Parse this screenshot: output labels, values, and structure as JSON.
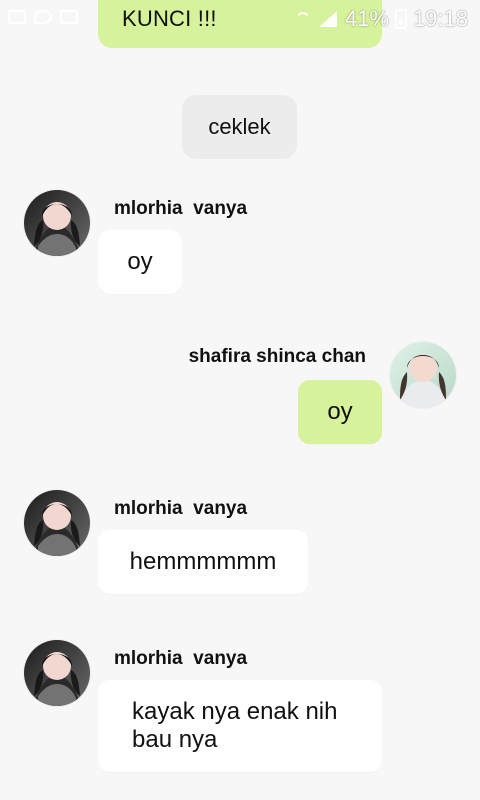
{
  "status_bar": {
    "battery": "41%",
    "time": "19:18",
    "left_icons": [
      "image-icon",
      "chat-icon",
      "youtube-icon"
    ],
    "right_icons": [
      "wifi-icon",
      "signal-icon",
      "battery-icon"
    ]
  },
  "chat": {
    "top_message": "KUNCI !!!",
    "system_message": "ceklek",
    "messages": [
      {
        "sender": "mlorhia  vanya",
        "text": "oy",
        "side": "left",
        "bubble_color": "#ffffff"
      },
      {
        "sender": "shafira shinca chan",
        "text": "oy",
        "side": "right",
        "bubble_color": "#d6f29a"
      },
      {
        "sender": "mlorhia  vanya",
        "text": "hemmmmmm",
        "side": "left",
        "bubble_color": "#ffffff"
      },
      {
        "sender": "mlorhia  vanya",
        "text": "kayak nya enak nih bau nya",
        "side": "left",
        "bubble_color": "#ffffff"
      }
    ]
  },
  "colors": {
    "background": "#f7f7f7",
    "green_bubble": "#d6f29a",
    "white_bubble": "#ffffff",
    "system_pill": "#ececec"
  }
}
